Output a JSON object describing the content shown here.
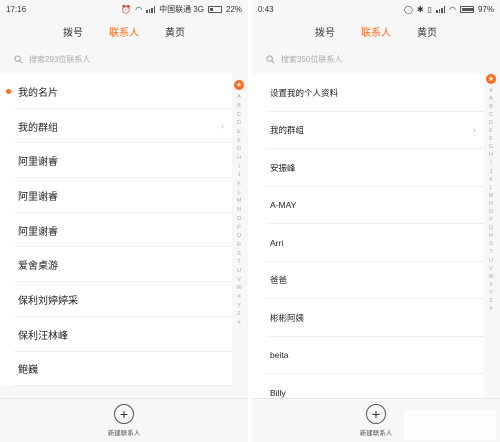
{
  "left": {
    "status": {
      "time": "17:16",
      "carrier": "中国联通 3G",
      "battery": "22%",
      "battery_level": 0.22
    },
    "tabs": [
      "拨号",
      "联系人",
      "黄页"
    ],
    "active_tab": 1,
    "search_placeholder": "搜索293位联系人",
    "rows": [
      "我的名片",
      "我的群组",
      "阿里谢睿",
      "阿里谢睿",
      "阿里谢睿",
      "爱舍桌游",
      "保利刘婷婷采",
      "保利汪林峰",
      "鲍巍"
    ],
    "index": [
      "A",
      "B",
      "C",
      "D",
      "E",
      "F",
      "G",
      "H",
      "I",
      "J",
      "K",
      "L",
      "M",
      "N",
      "O",
      "P",
      "Q",
      "R",
      "S",
      "T",
      "U",
      "V",
      "W",
      "X",
      "Y",
      "Z",
      "#"
    ],
    "add_label": "新建联系人"
  },
  "right": {
    "status": {
      "time": "0:43",
      "battery": "97%",
      "battery_level": 0.97
    },
    "tabs": [
      "拨号",
      "联系人",
      "黄页"
    ],
    "active_tab": 1,
    "search_placeholder": "搜索350位联系人",
    "rows": [
      "设置我的个人资料",
      "我的群组",
      "安振峰",
      "A-MAY",
      "Arri",
      "爸爸",
      "彬彬阿姨",
      "beita",
      "Billy"
    ],
    "index": [
      "#",
      "A",
      "B",
      "C",
      "D",
      "E",
      "F",
      "G",
      "H",
      "I",
      "J",
      "K",
      "L",
      "M",
      "N",
      "O",
      "P",
      "Q",
      "R",
      "S",
      "T",
      "U",
      "V",
      "W",
      "X",
      "Y",
      "Z",
      "#"
    ],
    "add_label": "新建联系人"
  },
  "colors": {
    "accent": "#ff6a1a"
  }
}
